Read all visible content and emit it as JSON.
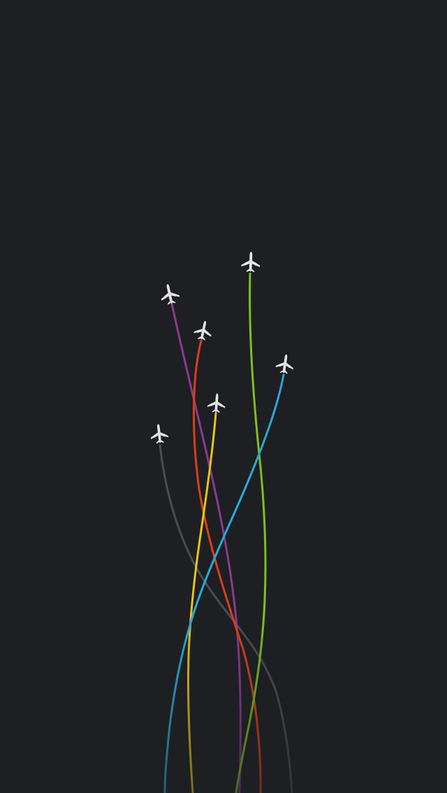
{
  "scene": {
    "background_color": "#1e1f23",
    "plane_color": "#e6e6e6",
    "planes": [
      {
        "icon": "airplane-icon",
        "trail_color": "#8a3a8f"
      },
      {
        "icon": "airplane-icon",
        "trail_color": "#d8401a"
      },
      {
        "icon": "airplane-icon",
        "trail_color": "#7fbf1f"
      },
      {
        "icon": "airplane-icon",
        "trail_color": "#e3c51b"
      },
      {
        "icon": "airplane-icon",
        "trail_color": "#2aa8d8"
      },
      {
        "icon": "airplane-icon",
        "trail_color": "#4a4c50"
      }
    ]
  }
}
